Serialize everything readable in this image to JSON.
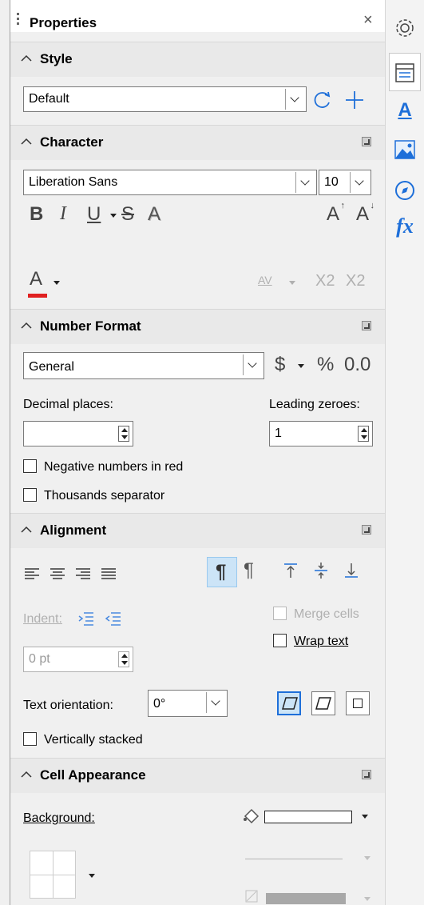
{
  "panel": {
    "title": "Properties",
    "close": "×"
  },
  "style": {
    "header": "Style",
    "value": "Default"
  },
  "character": {
    "header": "Character",
    "font": "Liberation Sans",
    "size": "10",
    "buttons": {
      "bold": "B",
      "italic": "I",
      "underline": "U",
      "strike": "S",
      "shadow": "A",
      "grow": "A",
      "shrink": "A",
      "font_color": "A",
      "spacing": "AV",
      "superscript": "X2",
      "subscript": "X2"
    }
  },
  "number_format": {
    "header": "Number Format",
    "format": "General",
    "currency": "$",
    "percent": "%",
    "decimal": "0.0",
    "decimal_places_label": "Decimal places:",
    "decimal_places_value": "",
    "leading_zeroes_label": "Leading zeroes:",
    "leading_zeroes_value": "1",
    "negative_red": "Negative numbers in red",
    "thousands": "Thousands separator"
  },
  "alignment": {
    "header": "Alignment",
    "indent_label": "Indent:",
    "indent_value": "0 pt",
    "merge_cells": "Merge cells",
    "wrap_text": "Wrap text",
    "orientation_label": "Text orientation:",
    "orientation_value": "0°",
    "vertically_stacked": "Vertically stacked"
  },
  "cell_appearance": {
    "header": "Cell Appearance",
    "background_label": "Background:"
  },
  "colors": {
    "accent": "#1e6fd9",
    "font_color_bar": "#e02020",
    "header_bg": "#e9e9e9"
  }
}
